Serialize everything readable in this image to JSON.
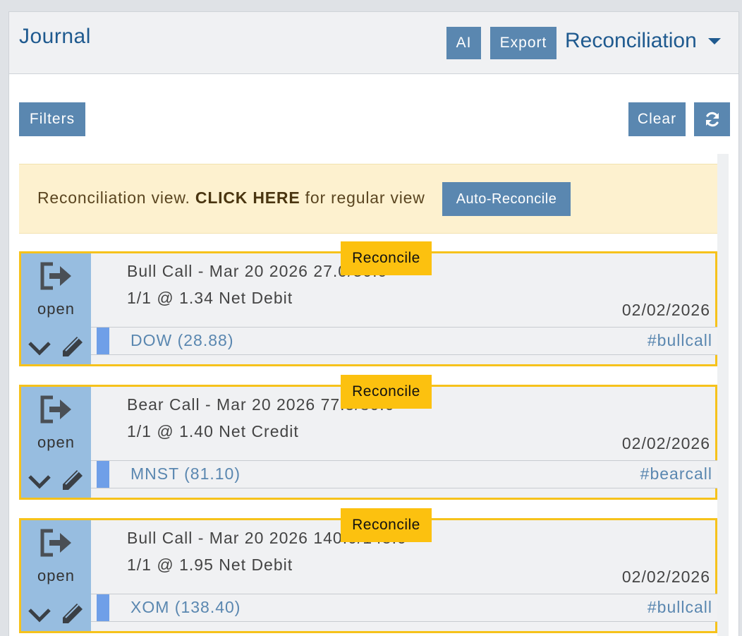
{
  "header": {
    "title": "Journal",
    "ai_label": "AI",
    "export_label": "Export",
    "view_selected": "Reconciliation"
  },
  "toolbar": {
    "filters_label": "Filters",
    "clear_label": "Clear",
    "refresh_icon": "refresh-icon"
  },
  "banner": {
    "text_before": "Reconciliation view. ",
    "link_text": "CLICK HERE",
    "text_after": " for regular view",
    "auto_reconcile_label": "Auto-Reconcile"
  },
  "colors": {
    "accent": "#5a87b0",
    "title_blue": "#1f5a8f",
    "reconcile_yellow": "#fcc10f",
    "card_border": "#f6c21b",
    "status_side": "#97bde0",
    "banner_bg": "#fdf1cf"
  },
  "cards": [
    {
      "status": "open",
      "line1": "Bull Call - Mar 20 2026 27.0/30.0",
      "line2": "1/1 @ 1.34 Net Debit",
      "date": "02/02/2026",
      "ticker": "DOW (28.88)",
      "tag": "#bullcall",
      "badge": "Reconcile"
    },
    {
      "status": "open",
      "line1": "Bear Call - Mar 20 2026 77.5/80.0",
      "line2": "1/1 @ 1.40 Net Credit",
      "date": "02/02/2026",
      "ticker": "MNST (81.10)",
      "tag": "#bearcall",
      "badge": "Reconcile"
    },
    {
      "status": "open",
      "line1": "Bull Call - Mar 20 2026 140.0/145.0",
      "line2": "1/1 @ 1.95 Net Debit",
      "date": "02/02/2026",
      "ticker": "XOM (138.40)",
      "tag": "#bullcall",
      "badge": "Reconcile"
    }
  ]
}
